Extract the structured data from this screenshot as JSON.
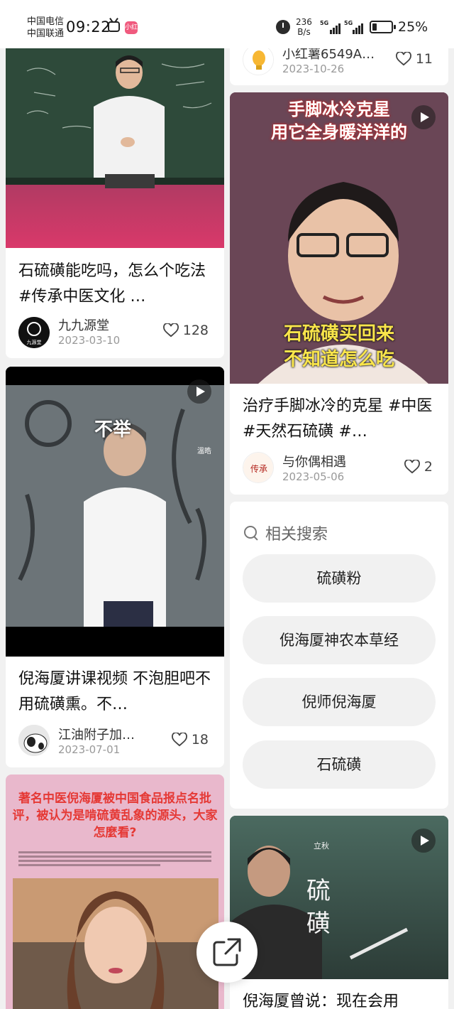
{
  "status_bar": {
    "carrier_1": "中国电信",
    "carrier_2": "中国联通",
    "time": "09:22",
    "app_badge": "小红",
    "net_speed": "236",
    "net_unit": "B/s",
    "signal_1": "5G",
    "signal_2": "5G",
    "battery_percent": "25%",
    "battery_level": 0.25
  },
  "feed": {
    "left": [
      {
        "title": "石硫磺能吃吗，怎么个吃法 #传承中医文化 …",
        "author": "九九源堂",
        "date": "2023-03-10",
        "likes": "128",
        "avatar_text": "九源堂"
      },
      {
        "title": "倪海厦讲课视频 不泡胆吧不用硫磺熏。不…",
        "author": "江油附子加…",
        "date": "2023-07-01",
        "likes": "18",
        "overlay_text": "不举",
        "watermark": "溫晧"
      },
      {
        "headline": "著名中医倪海厦被中国食品报点名批评，被认为是啃硫黄乱象的源头，大家怎麼看?"
      }
    ],
    "right": [
      {
        "author": "小红薯6549A…",
        "date": "2023-10-26",
        "likes": "11"
      },
      {
        "title": "治疗手脚冰冷的克星 #中医 #天然石硫磺 #…",
        "author": "与你偶相遇",
        "date": "2023-05-06",
        "likes": "2",
        "overlay_top_1": "手脚冰冷克星",
        "overlay_top_2": "用它全身暖洋洋的",
        "overlay_bottom_1": "石硫磺买回来",
        "overlay_bottom_2": "不知道怎么吃",
        "avatar_text": "传承"
      },
      {
        "title": "倪海厦曾说：现在会用",
        "video_text_1": "硫",
        "video_text_2": "磺",
        "video_small": "立秋"
      }
    ]
  },
  "related": {
    "heading": "相关搜索",
    "items": [
      "硫磺粉",
      "倪海厦神农本草经",
      "倪师倪海厦",
      "石硫磺"
    ]
  },
  "colors": {
    "accent_red": "#e53935",
    "chip_bg": "#f1f1f1",
    "card_bg": "#ffffff",
    "page_bg": "#f1f1f1"
  }
}
